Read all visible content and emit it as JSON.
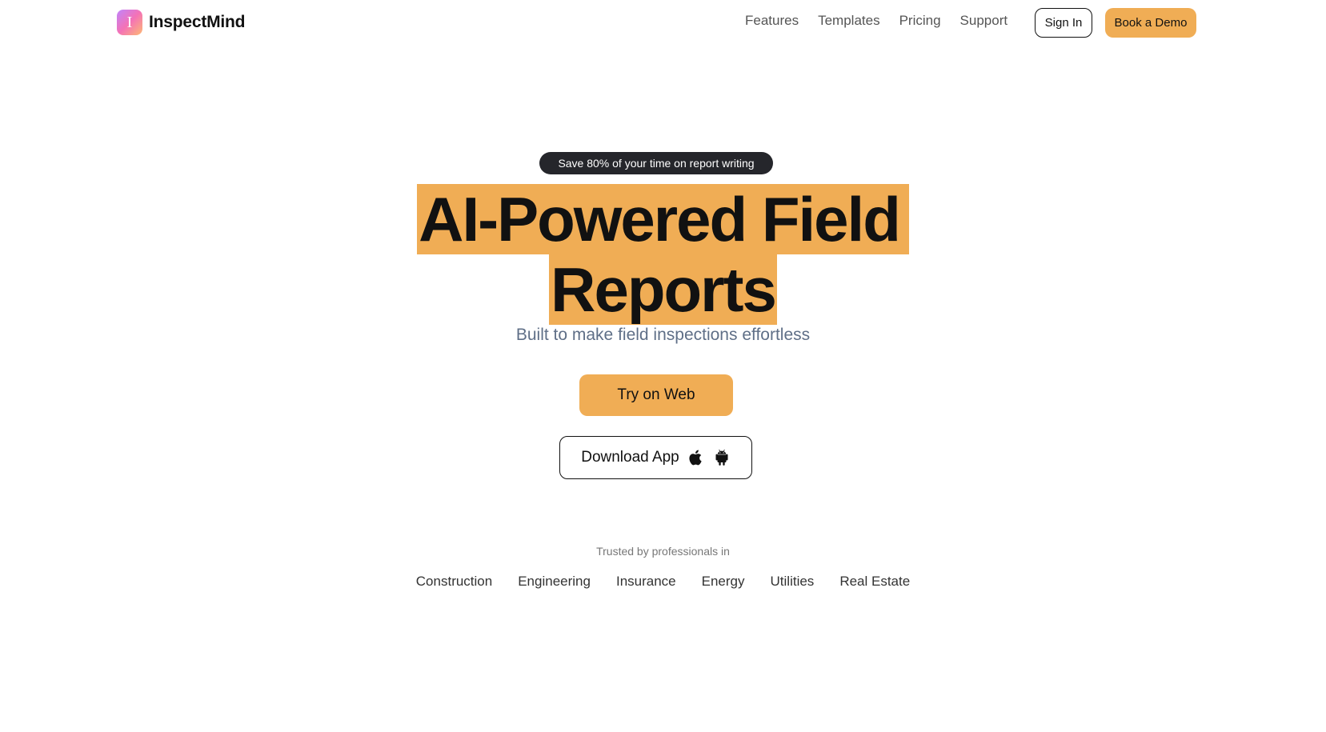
{
  "brand": {
    "logo_letter": "I",
    "name": "InspectMind"
  },
  "nav": {
    "links": [
      "Features",
      "Templates",
      "Pricing",
      "Support"
    ],
    "sign_in": "Sign In",
    "book_demo": "Book a Demo"
  },
  "hero": {
    "badge": "Save 80% of your time on report writing",
    "title_line1": "AI-Powered Field",
    "title_line2": "Reports",
    "subtitle": "Built to make field inspections effortless",
    "try_button": "Try on Web",
    "download_button": "Download App",
    "download_icons": [
      "apple-icon",
      "android-icon"
    ]
  },
  "trusted": {
    "label": "Trusted by professionals in",
    "industries": [
      "Construction",
      "Engineering",
      "Insurance",
      "Energy",
      "Utilities",
      "Real Estate"
    ]
  },
  "colors": {
    "accent": "#f0ad55",
    "badge_bg": "#25262b",
    "subtitle": "#5f6f87"
  }
}
